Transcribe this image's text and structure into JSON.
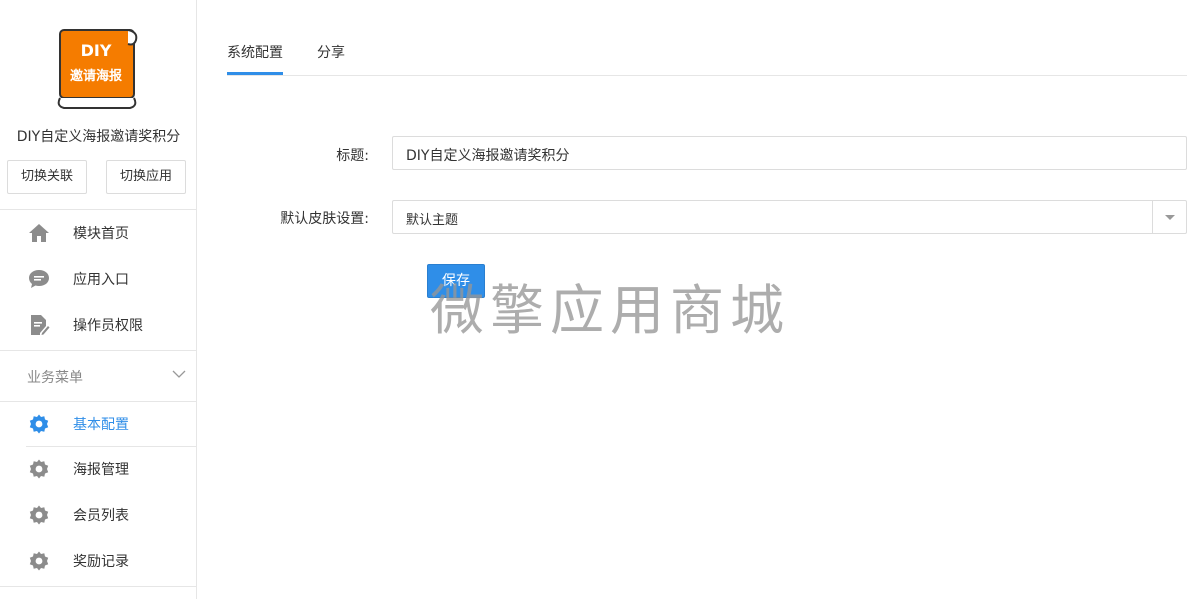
{
  "app": {
    "logo_text_top": "DIY",
    "logo_text_bottom": "邀请海报",
    "name": "DIY自定义海报邀请奖积分",
    "switch_link_label": "切换关联",
    "switch_app_label": "切换应用"
  },
  "sidebar": {
    "items": [
      {
        "label": "模块首页",
        "icon": "home-icon"
      },
      {
        "label": "应用入口",
        "icon": "chat-bubble-icon"
      },
      {
        "label": "操作员权限",
        "icon": "document-edit-icon"
      }
    ],
    "group": {
      "label": "业务菜单",
      "icon": "chevron-down-icon"
    },
    "group_items": [
      {
        "label": "基本配置",
        "icon": "gear-icon",
        "active": true
      },
      {
        "label": "海报管理",
        "icon": "gear-icon"
      },
      {
        "label": "会员列表",
        "icon": "gear-icon"
      },
      {
        "label": "奖励记录",
        "icon": "gear-icon"
      }
    ]
  },
  "tabs": [
    {
      "label": "系统配置",
      "active": true
    },
    {
      "label": "分享"
    }
  ],
  "form": {
    "title_label": "标题:",
    "title_value": "DIY自定义海报邀请奖积分",
    "skin_label": "默认皮肤设置:",
    "skin_value": "默认主题",
    "save_label": "保存"
  },
  "watermark": "微擎应用商城",
  "colors": {
    "accent": "#2f8ee8",
    "logo_orange": "#f57c00",
    "icon_gray": "#8c8c8c"
  }
}
